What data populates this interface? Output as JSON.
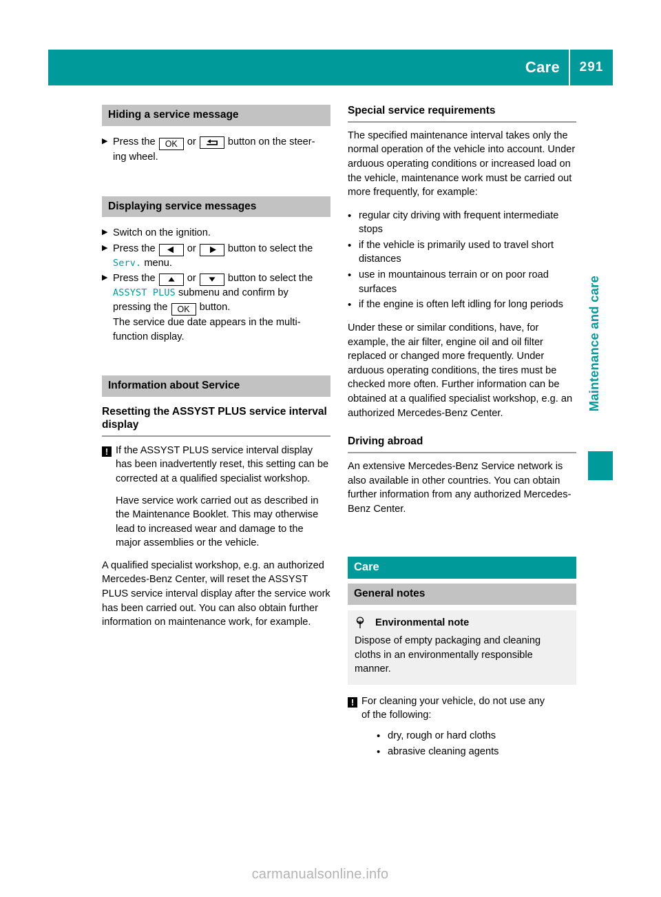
{
  "header": {
    "title": "Care",
    "page_number": "291",
    "accent_color": "#009a9a"
  },
  "side_tab": {
    "label": "Maintenance and care"
  },
  "watermark": {
    "text": "carmanualsonline.info"
  },
  "left_column": {
    "section_hiding": {
      "heading": "Hiding a service message",
      "step_marker": "X",
      "step_pre": "Press the",
      "key_ok": "OK",
      "step_or": "or",
      "key_back_icon": "back-arrow-icon",
      "step_post": "button on the steer-",
      "step_post2": "ing wheel."
    },
    "section_displaying": {
      "heading": "Displaying service messages",
      "step1_marker": "X",
      "step1": "Switch on the ignition.",
      "step2_marker": "X",
      "step2_pre": "Press the",
      "step2_key_left_icon": "arrow-left-icon",
      "step2_or": "or",
      "step2_key_right_icon": "arrow-right-icon",
      "step2_post": "button to select the",
      "step2_mfd": "Serv.",
      "step2_tail": "menu.",
      "step3_marker": "X",
      "step3_pre": "Press the",
      "step3_key_up_icon": "arrow-up-icon",
      "step3_or": "or",
      "step3_key_down_icon": "arrow-down-icon",
      "step3_post": "button to select the",
      "step3_mfd": "ASSYST PLUS",
      "step3_tail": "submenu and confirm by",
      "step3_tail2_pre": "pressing the",
      "step3_key_ok": "OK",
      "step3_tail2_post": "button.",
      "step3_result1": "The service due date appears in the multi-",
      "step3_result2": "function display."
    },
    "section_information": {
      "gray_heading": "Information about Service",
      "sub_heading": "Resetting the ASSYST PLUS service interval display",
      "warning_icon": "!",
      "warning_p1": "If the ASSYST PLUS service interval display has been inadvertently reset, this setting can be corrected at a qualified specialist workshop.",
      "warning_p2": "Have service work carried out as described in the Maintenance Booklet. This may otherwise lead to increased wear and damage to the major assemblies or the vehicle.",
      "body": "A qualified specialist workshop, e.g. an authorized Mercedes-Benz Center, will reset the ASSYST PLUS service interval display after the service work has been carried out. You can also obtain further information on maintenance work, for example."
    }
  },
  "right_column": {
    "section_special": {
      "heading": "Special service requirements",
      "intro": "The specified maintenance interval takes only the normal operation of the vehicle into account. Under arduous operating conditions or increased load on the vehicle, maintenance work must be carried out more frequently, for example:",
      "bullets": [
        "regular city driving with frequent intermediate stops",
        "if the vehicle is primarily used to travel short distances",
        "use in mountainous terrain or on poor road surfaces",
        "if the engine is often left idling for long periods"
      ],
      "outro": "Under these or similar conditions, have, for example, the air filter, engine oil and oil filter replaced or changed more frequently. Under arduous operating conditions, the tires must be checked more often. Further information can be obtained at a qualified specialist workshop, e.g. an authorized Mercedes-Benz Center."
    },
    "section_driving_abroad": {
      "heading": "Driving abroad",
      "body": "An extensive Mercedes-Benz Service network is also available in other countries. You can obtain further information from any authorized Mercedes-Benz Center."
    },
    "section_care": {
      "teal_heading": "Care",
      "gray_heading": "General notes",
      "note": {
        "icon": "environmental-tree-icon",
        "title": "Environmental note",
        "body": "Dispose of empty packaging and cleaning cloths in an environmentally responsible manner."
      },
      "warning_icon": "!",
      "warning_line1": "For cleaning your vehicle, do not use any",
      "warning_line2": "of the following:",
      "warning_bullets": [
        "dry, rough or hard cloths",
        "abrasive cleaning agents"
      ]
    }
  }
}
